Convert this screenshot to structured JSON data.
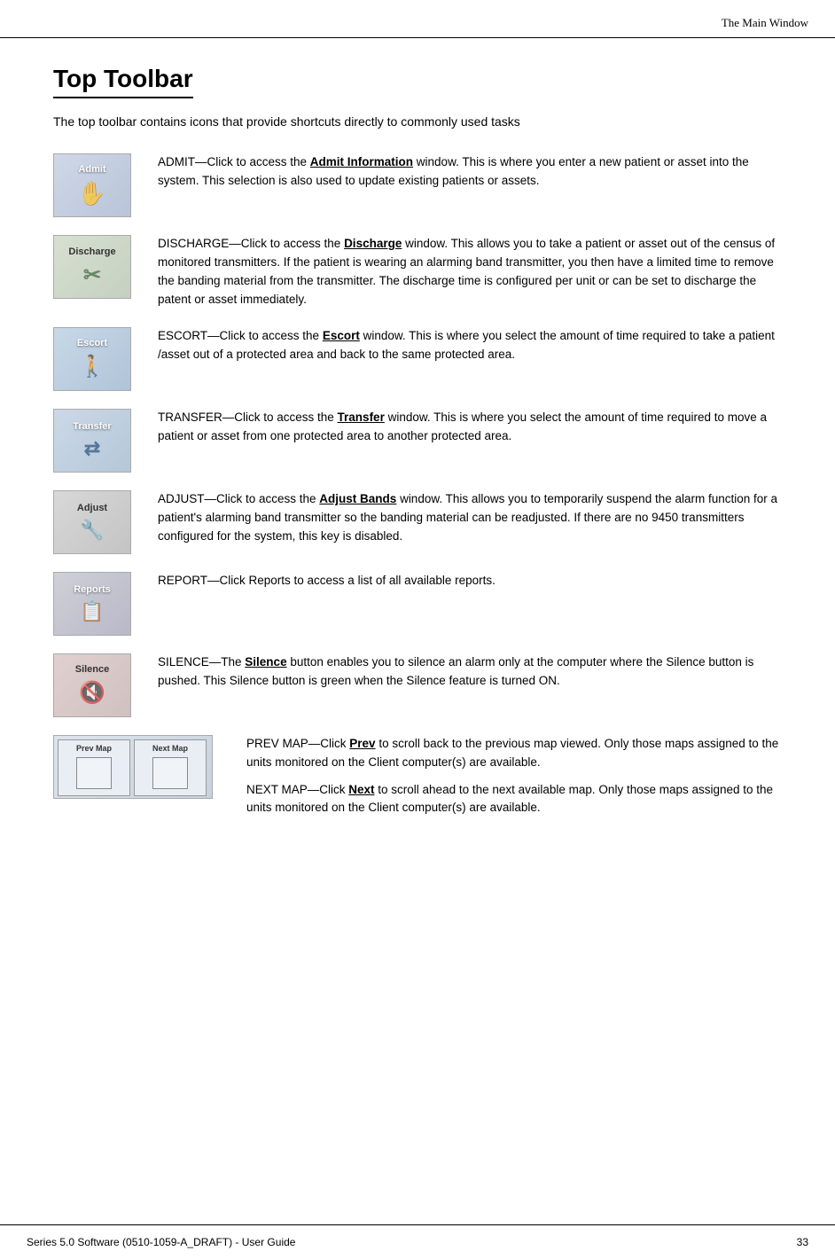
{
  "header": {
    "title": "The Main Window"
  },
  "page": {
    "title": "Top Toolbar",
    "intro": "The top toolbar contains icons that provide shortcuts directly to commonly used tasks"
  },
  "items": [
    {
      "id": "admit",
      "label": "Admit",
      "description_parts": [
        {
          "prefix": "ADMIT—Click to access the ",
          "bold": "Admit Information",
          "suffix": " window. This is where you enter a new patient or asset into the system. This selection is also used to update existing patients or assets."
        }
      ]
    },
    {
      "id": "discharge",
      "label": "Discharge",
      "description_parts": [
        {
          "prefix": "DISCHARGE—Click to access the ",
          "bold": "Discharge",
          "suffix": " window. This allows you to take a patient or asset out of the census of monitored transmitters. If the patient is wearing an alarming band transmitter, you then have a limited time to remove the banding material from the transmitter. The discharge time is configured per unit or can be set to discharge the patent or asset immediately."
        }
      ]
    },
    {
      "id": "escort",
      "label": "Escort",
      "description_parts": [
        {
          "prefix": "ESCORT—Click to access the ",
          "bold": "Escort",
          "suffix": " window. This is where you select the amount of time required to take a patient /asset out of a protected area and back to the same protected area."
        }
      ]
    },
    {
      "id": "transfer",
      "label": "Transfer",
      "description_parts": [
        {
          "prefix": "TRANSFER—Click to access the ",
          "bold": "Transfer",
          "suffix": " window. This is where you select the amount of time required to move a patient or asset from one protected area to another protected area."
        }
      ]
    },
    {
      "id": "adjust",
      "label": "Adjust",
      "description_parts": [
        {
          "prefix": "ADJUST—Click to access the ",
          "bold": "Adjust Bands",
          "suffix": " window. This allows you to temporarily suspend the alarm function for a patient's alarming band transmitter so the banding material can be readjusted. If there are no 9450 transmitters configured for the system, this key is disabled."
        }
      ]
    },
    {
      "id": "reports",
      "label": "Reports",
      "description_parts": [
        {
          "prefix": "REPORT—Click Reports to access a list of all available reports.",
          "bold": "",
          "suffix": ""
        }
      ]
    },
    {
      "id": "silence",
      "label": "Silence",
      "description_parts": [
        {
          "prefix": "SILENCE—The ",
          "bold": "Silence",
          "suffix": " button enables you to silence an alarm only at the computer where the Silence button is pushed. This Silence button is green when the Silence feature is turned ON."
        }
      ]
    },
    {
      "id": "prevnext",
      "label": "Prev Map / Next Map",
      "description_parts": [
        {
          "prefix": "PREV MAP—Click ",
          "bold": "Prev",
          "suffix": " to scroll back to the previous map viewed. Only those maps assigned to the units monitored on the Client computer(s) are available."
        },
        {
          "prefix": "NEXT MAP—Click ",
          "bold": "Next",
          "suffix": " to scroll ahead to the next available map. Only those maps assigned to the units monitored on the Client computer(s) are available."
        }
      ]
    }
  ],
  "footer": {
    "left": "Series 5.0 Software (0510-1059-A_DRAFT) - User Guide",
    "right": "33"
  }
}
